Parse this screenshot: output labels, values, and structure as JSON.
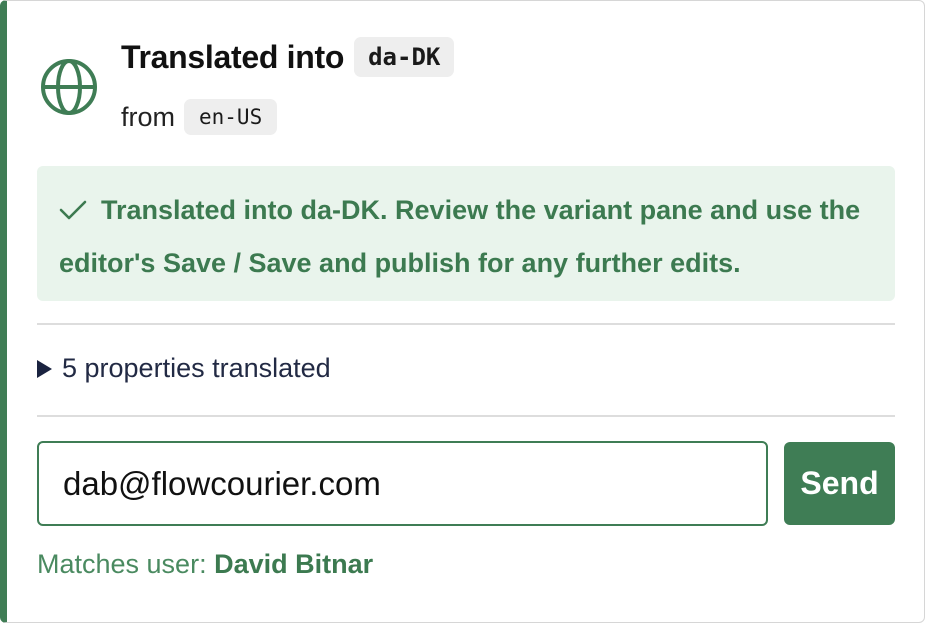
{
  "header": {
    "icon": "globe-icon",
    "title": "Translated into",
    "target_locale": "da-DK",
    "from_label": "from",
    "source_locale": "en-US"
  },
  "success": {
    "icon": "checkmark-icon",
    "message": "Translated into da-DK. Review the variant pane and use the editor's Save / Save and publish for any further edits."
  },
  "details": {
    "summary": "5 properties translated",
    "expanded": false
  },
  "share": {
    "email_value": "dab@flowcourier.com",
    "send_label": "Send",
    "matches_prefix": "Matches user:",
    "matches_name": "David Bitnar"
  },
  "colors": {
    "accent": "#3f7d55",
    "success_bg": "#e9f4ec",
    "success_text": "#3c7a50"
  }
}
